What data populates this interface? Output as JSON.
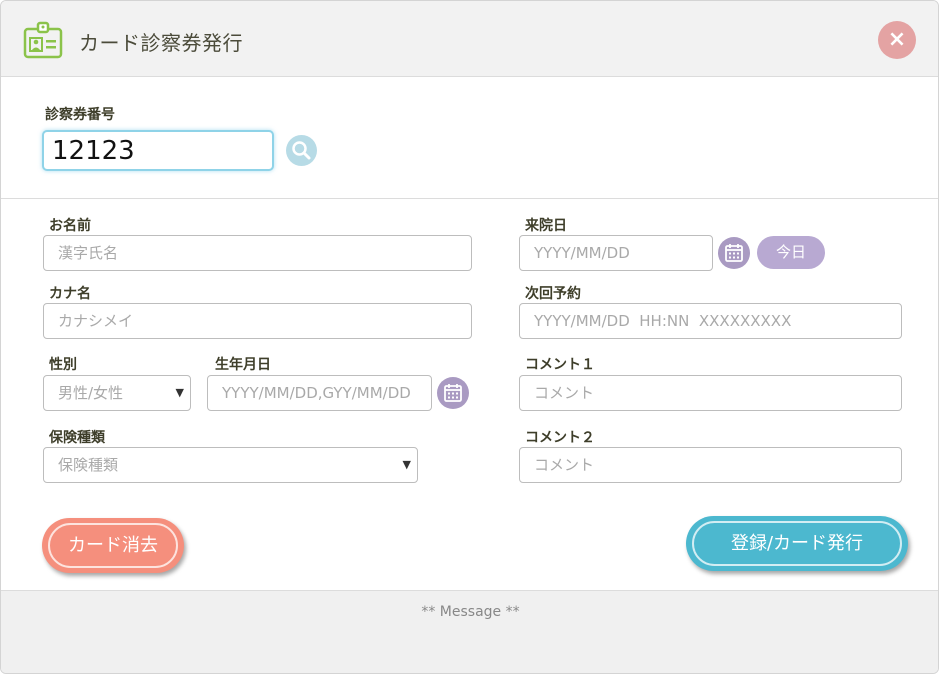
{
  "header": {
    "title": "カード診察券発行",
    "close_label": "×"
  },
  "card_number": {
    "label": "診察券番号",
    "value": "12123"
  },
  "left_form": {
    "name": {
      "label": "お名前",
      "placeholder": "漢字氏名"
    },
    "kana": {
      "label": "カナ名",
      "placeholder": "カナシメイ"
    },
    "gender": {
      "label": "性別",
      "selected": "男性/女性"
    },
    "birthdate": {
      "label": "生年月日",
      "placeholder": "YYYY/MM/DD,GYY/MM/DD"
    },
    "insurance": {
      "label": "保険種類",
      "selected": "保険種類"
    }
  },
  "right_form": {
    "visit_date": {
      "label": "来院日",
      "placeholder": "YYYY/MM/DD",
      "today_label": "今日"
    },
    "next_appointment": {
      "label": "次回予約",
      "placeholder": "YYYY/MM/DD  HH:NN  XXXXXXXXX"
    },
    "comment1": {
      "label": "コメント１",
      "placeholder": "コメント"
    },
    "comment2": {
      "label": "コメント２",
      "placeholder": "コメント"
    }
  },
  "buttons": {
    "clear_label": "カード消去",
    "register_label": "登録/カード発行"
  },
  "footer": {
    "message": "** Message **"
  },
  "colors": {
    "clear_button": "#f58f7d",
    "register_button": "#4cb8cf",
    "calendar_button": "#a99ac2",
    "close_button": "#e4a3a3",
    "logo": "#8bc34a"
  },
  "icons": [
    "id-card-icon",
    "close-icon",
    "search-icon",
    "calendar-icon",
    "chevron-down-icon"
  ]
}
